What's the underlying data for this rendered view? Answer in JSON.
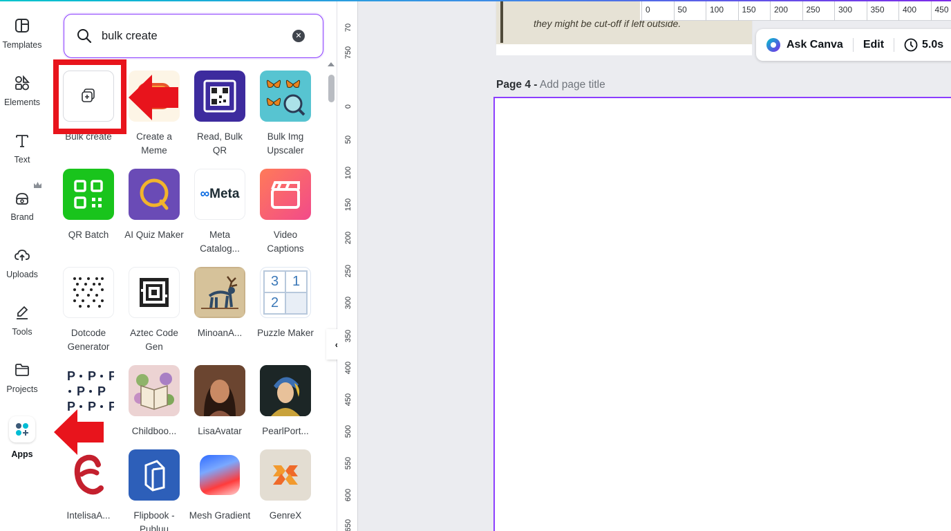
{
  "rail": {
    "items": [
      {
        "label": "Templates",
        "icon": "templates-icon"
      },
      {
        "label": "Elements",
        "icon": "elements-icon"
      },
      {
        "label": "Text",
        "icon": "text-icon"
      },
      {
        "label": "Brand",
        "icon": "brand-icon"
      },
      {
        "label": "Uploads",
        "icon": "uploads-icon"
      },
      {
        "label": "Tools",
        "icon": "tools-icon"
      },
      {
        "label": "Projects",
        "icon": "projects-icon"
      },
      {
        "label": "Apps",
        "icon": "apps-icon"
      }
    ]
  },
  "search": {
    "value": "bulk create",
    "placeholder": "Search"
  },
  "apps": [
    {
      "label": "Bulk create"
    },
    {
      "label": "Create a Meme"
    },
    {
      "label": "Read, Bulk QR"
    },
    {
      "label": "Bulk Img Upscaler"
    },
    {
      "label": "QR Batch"
    },
    {
      "label": "AI Quiz Maker"
    },
    {
      "label": "Meta Catalog..."
    },
    {
      "label": "Video Captions"
    },
    {
      "label": "Dotcode Generator"
    },
    {
      "label": "Aztec Code Gen"
    },
    {
      "label": "MinoanA..."
    },
    {
      "label": "Puzzle Maker"
    },
    {
      "label": "...e..."
    },
    {
      "label": "Childboo..."
    },
    {
      "label": "LisaAvatar"
    },
    {
      "label": "PearlPort..."
    },
    {
      "label": "IntelisaA..."
    },
    {
      "label": "Flipbook - Publuu"
    },
    {
      "label": "Mesh Gradient"
    },
    {
      "label": "GenreX"
    }
  ],
  "meta_logo_text": "Meta",
  "puzzle_digits": [
    "3",
    "1",
    "2"
  ],
  "ruler_top": [
    "0",
    "50",
    "100",
    "150",
    "200",
    "250",
    "300",
    "350",
    "400",
    "450"
  ],
  "ruler_left": [
    "70",
    "750",
    "0",
    "50",
    "100",
    "150",
    "200",
    "250",
    "300",
    "350",
    "400",
    "450",
    "500",
    "550",
    "600",
    "650"
  ],
  "canvas": {
    "prev_page_text": "they might be cut-off if left outside.",
    "page_label": "Page 4 -",
    "page_title_placeholder": "Add page title"
  },
  "ask_toolbar": {
    "ask": "Ask Canva",
    "edit": "Edit",
    "duration": "5.0s"
  },
  "colors": {
    "accent": "#8b3dff",
    "highlight": "#e8141c"
  }
}
